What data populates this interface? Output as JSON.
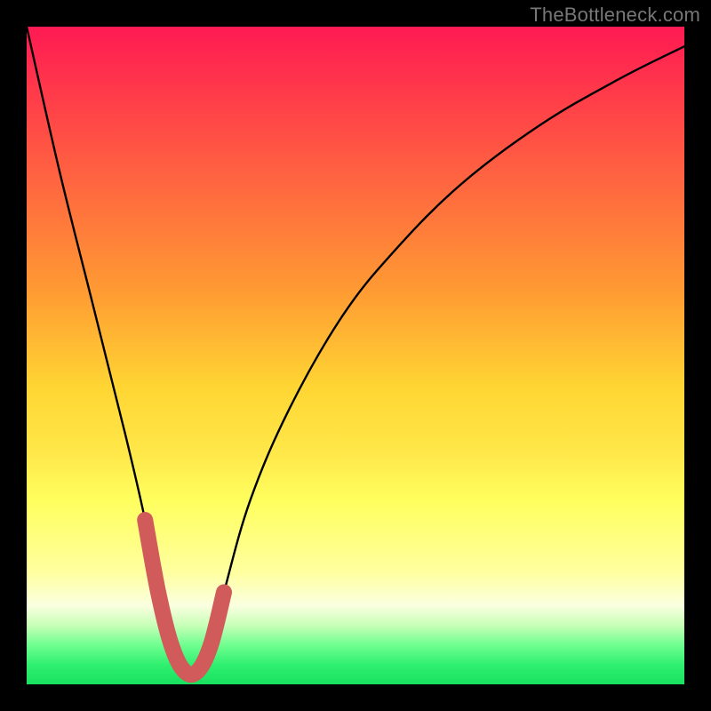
{
  "watermark": "TheBottleneck.com",
  "colors": {
    "border": "#000000",
    "curve": "#000000",
    "highlight": "#d15a5a",
    "gradient_top": "#ff1a53",
    "gradient_bottom": "#18e060"
  },
  "chart_data": {
    "type": "line",
    "title": "",
    "xlabel": "",
    "ylabel": "",
    "xlim": [
      0,
      100
    ],
    "ylim": [
      0,
      100
    ],
    "grid": false,
    "legend": false,
    "series": [
      {
        "name": "bottleneck-curve",
        "x": [
          0,
          5,
          10,
          15,
          18,
          20,
          22,
          24,
          26,
          28,
          30,
          34,
          40,
          48,
          56,
          66,
          78,
          90,
          100
        ],
        "y": [
          100,
          78,
          58,
          38,
          25,
          14,
          6,
          2,
          2,
          6,
          14,
          28,
          42,
          56,
          66,
          76,
          85,
          92,
          97
        ]
      },
      {
        "name": "highlight-region",
        "x": [
          18,
          20,
          22,
          24,
          26,
          28,
          30
        ],
        "y": [
          25,
          14,
          6,
          2,
          2,
          6,
          14
        ]
      }
    ]
  }
}
